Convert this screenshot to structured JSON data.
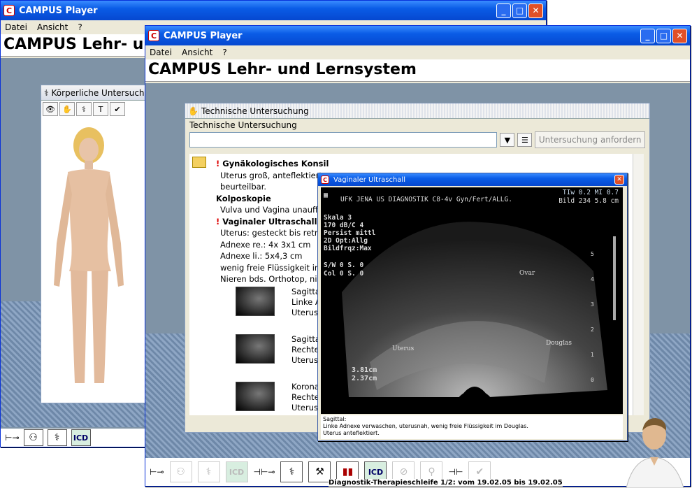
{
  "back_window": {
    "title": "CAMPUS Player",
    "menu": [
      "Datei",
      "Ansicht",
      "?"
    ],
    "big_title": "CAMPUS Lehr- u",
    "panel_title": "Körperliche Untersuch"
  },
  "front_window": {
    "title": "CAMPUS Player",
    "menu": [
      "Datei",
      "Ansicht",
      "?"
    ],
    "big_title": "CAMPUS Lehr- und Lernsystem"
  },
  "tech": {
    "window_title": "Technische Untersuchung",
    "section_label": "Technische Untersuchung",
    "request_button": "Untersuchung anfordern",
    "lines": [
      {
        "t": "Gynäkologisches Konsil",
        "h": true,
        "excl": true
      },
      {
        "t": "Uterus groß, anteflektiert,"
      },
      {
        "t": "beurteilbar."
      },
      {
        "t": "Kolposkopie",
        "h": true
      },
      {
        "t": "Vulva und Vagina unauffäl"
      },
      {
        "t": "Vaginaler Ultraschall",
        "h": true,
        "excl": true
      },
      {
        "t": "Uterus: gesteckt bis retrof"
      },
      {
        "t": "Adnexe re.: 4x 3x1 cm"
      },
      {
        "t": "Adnexe li.: 5x4,3 cm"
      },
      {
        "t": "wenig freie Flüssigkeit im"
      },
      {
        "t": "Nieren bds. Orthotop, nich"
      }
    ],
    "thumbs": [
      [
        "Sagitta",
        "Linke A",
        "Uterus"
      ],
      [
        "Sagitta",
        "Rechte",
        "Uterus"
      ],
      [
        "Korona",
        "Rechte",
        "Uterus"
      ]
    ]
  },
  "us": {
    "title": "Vaginaler Ultraschall",
    "header": "UFK JENA US DIAGNOSTIK  C8-4v Gyn/Fert/ALLG.",
    "tlw": "TIw 0.2  MI 0.7",
    "bild": "Bild 234 5.8 cm",
    "params": [
      "Skala 3",
      "170 dB/C 4",
      "Persist mittl",
      "2D Opt:Allg",
      "Bildfrqz:Max"
    ],
    "sw": "S/W 0    S. 0",
    "col": "Col 0    S. 0",
    "labels": {
      "ovar": "Ovar",
      "uterus": "Uterus",
      "douglas": "Douglas"
    },
    "meas": [
      "3.81cm",
      "2.37cm"
    ],
    "scale": [
      "5",
      "4",
      "3",
      "2",
      "1",
      "0"
    ],
    "caption": [
      "Sagittal:",
      "Linke Adnexe verwaschen, uterusnah, wenig freie Flüssigkeit im Douglas.",
      "Uterus anteflektiert."
    ]
  },
  "status": "Diagnostik-Therapieschleife 1/2: vom 19.02.05 bis 19.02.05",
  "icd": "ICD"
}
